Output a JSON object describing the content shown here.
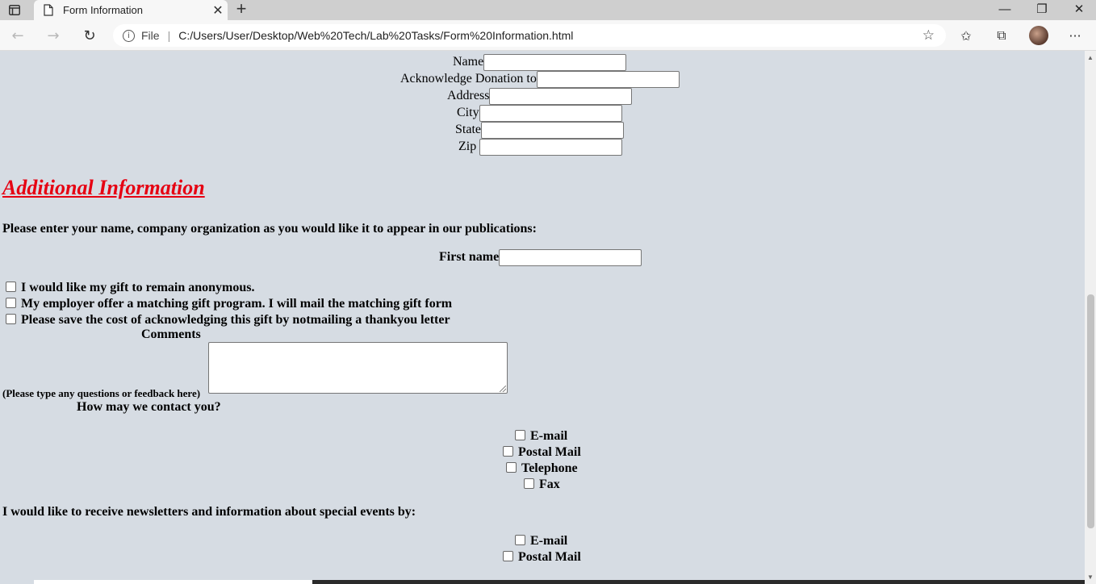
{
  "browser": {
    "tab_title": "Form Information",
    "close_tab": "✕",
    "new_tab": "+",
    "win_min": "—",
    "win_restore": "❐",
    "win_close": "✕",
    "back": "←",
    "forward": "→",
    "reload": "↻",
    "info": "i",
    "file_label": "File",
    "separator": "|",
    "url": "C:/Users/User/Desktop/Web%20Tech/Lab%20Tasks/Form%20Information.html",
    "add_fav": "☆",
    "favorites": "✩",
    "collections": "⧉",
    "menu": "···"
  },
  "donor_fields": [
    {
      "label": "Name"
    },
    {
      "label": "Acknowledge Donation to"
    },
    {
      "label": "Address"
    },
    {
      "label": "City"
    },
    {
      "label": "State"
    },
    {
      "label": "Zip"
    }
  ],
  "additional": {
    "heading": "Additional Information",
    "publications_prompt": "Please enter your name, company organization as you would like it to appear in our publications:",
    "first_name_label": "First name",
    "options": [
      "I would like my gift to remain anonymous.",
      "My employer offer a matching gift program. I will mail the matching gift form",
      "Please save the cost of acknowledging this gift by notmailing a thankyou letter"
    ],
    "comments_label": "Comments",
    "comments_hint": "(Please type any questions or feedback here)",
    "contact_label": "How may we contact you?",
    "contact_options": [
      "E-mail",
      "Postal Mail",
      "Telephone",
      "Fax"
    ],
    "newsletter_prompt": "I would like to receive newsletters and information about special events by:",
    "newsletter_options": [
      "E-mail",
      "Postal Mail"
    ]
  }
}
